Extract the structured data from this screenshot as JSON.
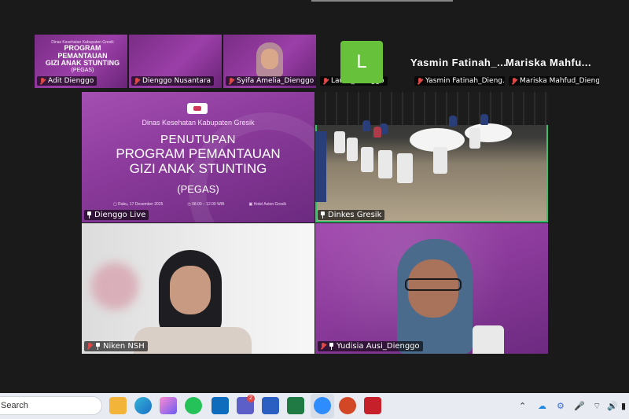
{
  "top_strip": [
    {
      "name": "Adit Dienggo"
    },
    {
      "name": "Dienggo Nusantara"
    },
    {
      "name": "Syifa Amelia_Dienggo"
    },
    {
      "name": "Laura_Dienggo",
      "avatar_letter": "L"
    },
    {
      "name": "Yasmin Fatinah_Dieng...",
      "display_name": "Yasmin  Fatinah_..."
    },
    {
      "name": "Mariska Mahfud_Dieng...",
      "display_name": "Mariska  Mahfu..."
    }
  ],
  "mini_slide": {
    "org": "Dinas Kesehatan Kabupaten Gresik",
    "line1": "PROGRAM PEMANTAUAN",
    "line2": "GIZI ANAK STUNTING",
    "line3": "(PEGAS)"
  },
  "main_grid": [
    {
      "name": "Dienggo Live"
    },
    {
      "name": "Dinkes Gresik"
    },
    {
      "name": "Niken NSH"
    },
    {
      "name": "Yudisia Ausi_Dienggo"
    }
  ],
  "slide": {
    "org": "Dinas Kesehatan Kabupaten Gresik",
    "heading": "PENUTUPAN",
    "title_line1": "PROGRAM PEMANTAUAN",
    "title_line2": "GIZI ANAK STUNTING",
    "title_line3": "(PEGAS)",
    "day": "Rabu,",
    "date": "17 Desember 2025",
    "time": "08.00 – 12.00 WIB",
    "venue": "Hotel Aston Gresik"
  },
  "taskbar": {
    "search_placeholder": "Search",
    "teams_badge": "2",
    "app_icons": [
      "file-explorer",
      "edge",
      "photos",
      "whatsapp",
      "outlook",
      "teams",
      "word",
      "excel",
      "zoom",
      "powerpoint",
      "acrobat"
    ]
  },
  "colors": {
    "active_speaker_border": "#35c070",
    "avatar_bg": "#68c13a",
    "slide_purple": "#8a3a9a",
    "muted_red": "#e04848"
  }
}
